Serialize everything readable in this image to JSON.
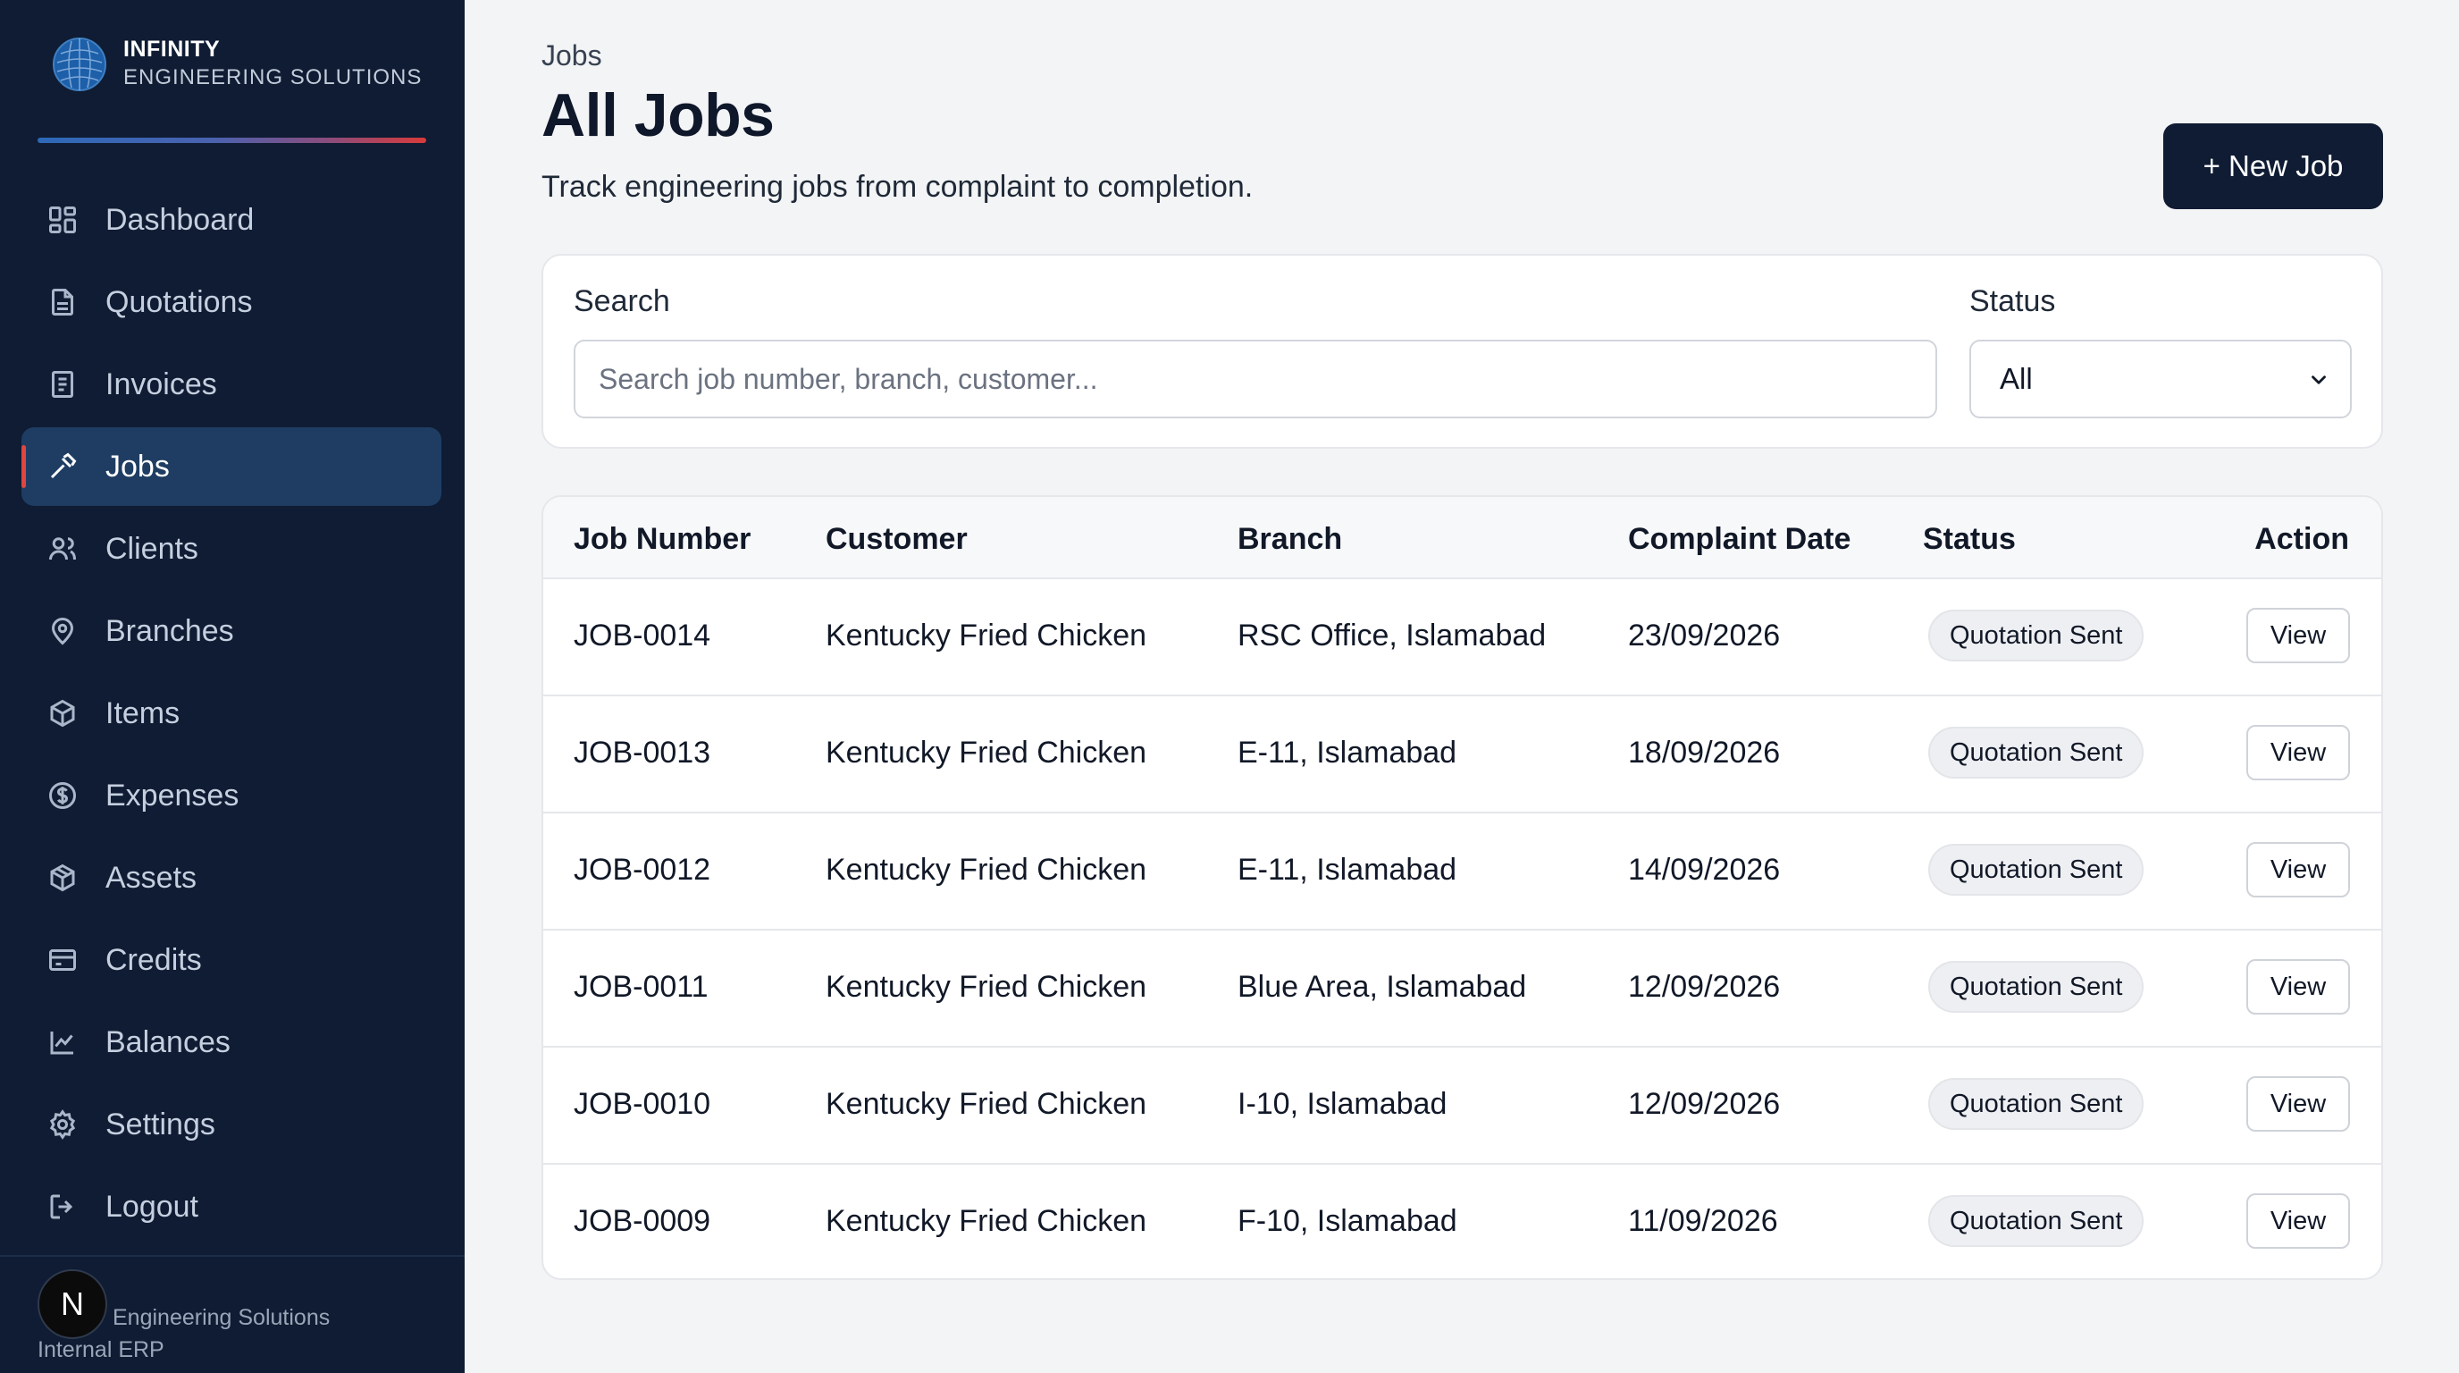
{
  "brand": {
    "name": "INFINITY",
    "subtitle": "ENGINEERING SOLUTIONS",
    "accent_gradient": [
      "#2d69b8",
      "#d93a3a"
    ]
  },
  "sidebar": {
    "items": [
      {
        "label": "Dashboard",
        "icon": "dashboard-grid-icon",
        "active": false
      },
      {
        "label": "Quotations",
        "icon": "document-icon",
        "active": false
      },
      {
        "label": "Invoices",
        "icon": "receipt-icon",
        "active": false
      },
      {
        "label": "Jobs",
        "icon": "hammer-icon",
        "active": true
      },
      {
        "label": "Clients",
        "icon": "users-icon",
        "active": false
      },
      {
        "label": "Branches",
        "icon": "map-pin-icon",
        "active": false
      },
      {
        "label": "Items",
        "icon": "box-icon",
        "active": false
      },
      {
        "label": "Expenses",
        "icon": "dollar-circle-icon",
        "active": false
      },
      {
        "label": "Assets",
        "icon": "package-icon",
        "active": false
      },
      {
        "label": "Credits",
        "icon": "credit-card-icon",
        "active": false
      },
      {
        "label": "Balances",
        "icon": "line-chart-icon",
        "active": false
      },
      {
        "label": "Settings",
        "icon": "gear-icon",
        "active": false
      },
      {
        "label": "Logout",
        "icon": "logout-icon",
        "active": false
      }
    ],
    "footer": {
      "avatar_letter": "N",
      "line1": "Engineering Solutions",
      "line2": "Internal ERP"
    }
  },
  "header": {
    "breadcrumb": "Jobs",
    "title": "All Jobs",
    "subtitle": "Track engineering jobs from complaint to completion.",
    "new_job_label": "+ New Job"
  },
  "filters": {
    "search_label": "Search",
    "search_placeholder": "Search job number, branch, customer...",
    "search_value": "",
    "status_label": "Status",
    "status_value": "All"
  },
  "table": {
    "columns": [
      "Job Number",
      "Customer",
      "Branch",
      "Complaint Date",
      "Status",
      "Action"
    ],
    "rows": [
      {
        "job": "JOB-0014",
        "customer": "Kentucky Fried Chicken",
        "branch": "RSC Office, Islamabad",
        "date": "23/09/2026",
        "status": "Quotation Sent",
        "action": "View"
      },
      {
        "job": "JOB-0013",
        "customer": "Kentucky Fried Chicken",
        "branch": "E-11, Islamabad",
        "date": "18/09/2026",
        "status": "Quotation Sent",
        "action": "View"
      },
      {
        "job": "JOB-0012",
        "customer": "Kentucky Fried Chicken",
        "branch": "E-11, Islamabad",
        "date": "14/09/2026",
        "status": "Quotation Sent",
        "action": "View"
      },
      {
        "job": "JOB-0011",
        "customer": "Kentucky Fried Chicken",
        "branch": "Blue Area, Islamabad",
        "date": "12/09/2026",
        "status": "Quotation Sent",
        "action": "View"
      },
      {
        "job": "JOB-0010",
        "customer": "Kentucky Fried Chicken",
        "branch": "I-10, Islamabad",
        "date": "12/09/2026",
        "status": "Quotation Sent",
        "action": "View"
      },
      {
        "job": "JOB-0009",
        "customer": "Kentucky Fried Chicken",
        "branch": "F-10, Islamabad",
        "date": "11/09/2026",
        "status": "Quotation Sent",
        "action": "View"
      }
    ]
  },
  "colors": {
    "sidebar_bg": "#0f1c33",
    "active_item_bg": "#1f3d63",
    "active_indicator": "#e0463f",
    "primary_button": "#0f1c33",
    "page_bg": "#f3f4f6"
  }
}
